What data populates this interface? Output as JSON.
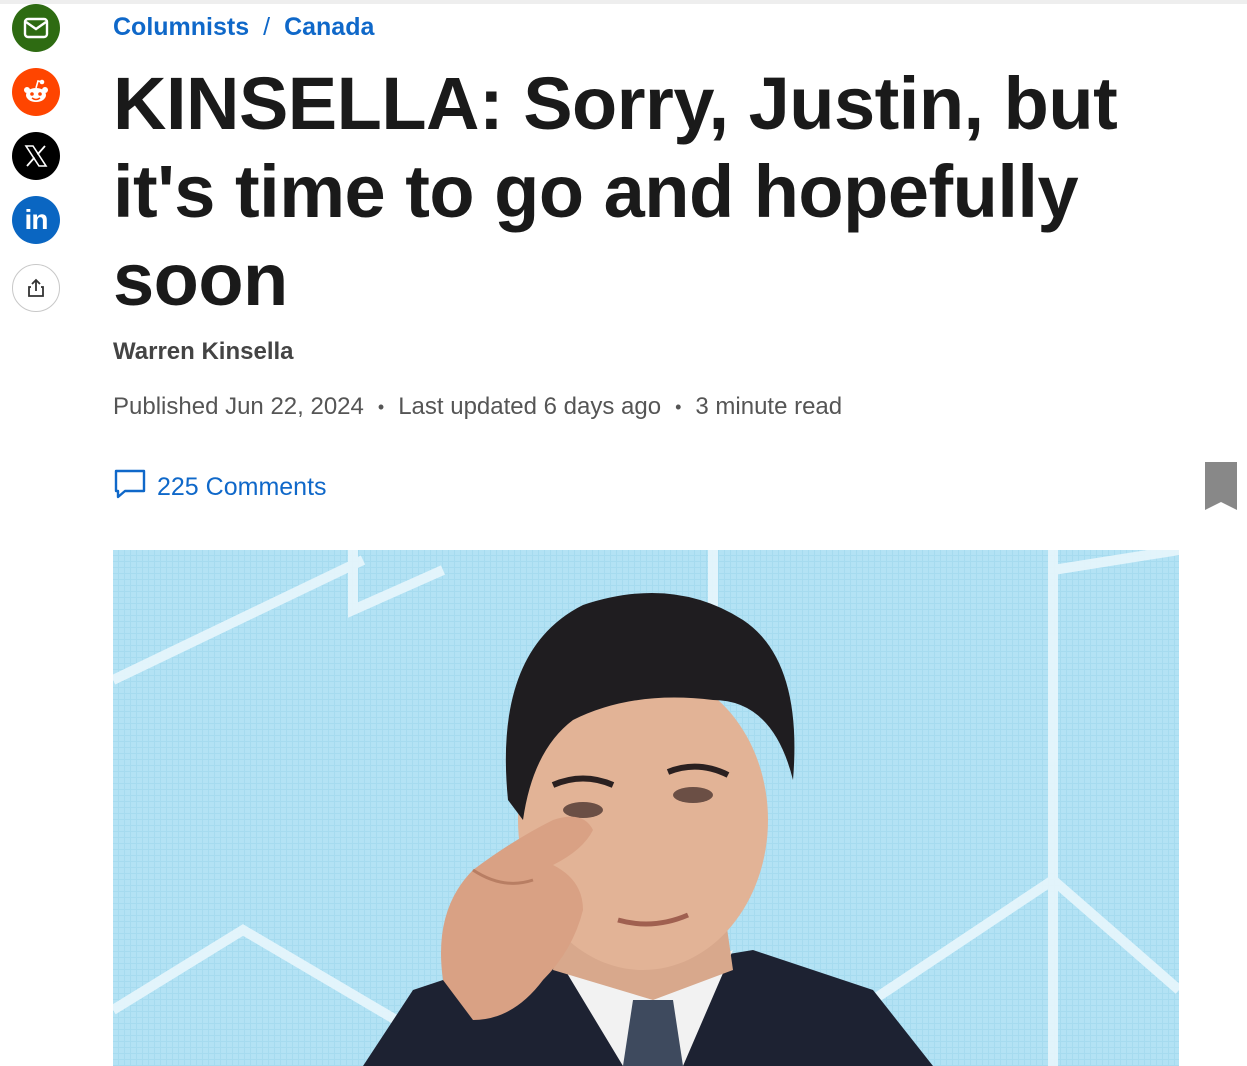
{
  "share": {
    "email_icon": "envelope-icon",
    "reddit_icon": "reddit-icon",
    "x_icon": "x-logo-icon",
    "linkedin_text": "in",
    "more_icon": "share-icon",
    "colors": {
      "email": "#2e6b12",
      "reddit": "#ff4500",
      "x": "#000000",
      "linkedin": "#0a66c2"
    }
  },
  "breadcrumb": {
    "items": [
      "Columnists",
      "Canada"
    ],
    "separator": "/"
  },
  "article": {
    "headline": "KINSELLA: Sorry, Justin, but it's time to go and hopefully soon",
    "author": "Warren Kinsella",
    "published": "Published Jun 22, 2024",
    "updated": "Last updated 6 days ago",
    "read_time": "3 minute read",
    "meta_separator": "•",
    "comments_label": "225 Comments"
  },
  "accent_color": "#0f68c9"
}
